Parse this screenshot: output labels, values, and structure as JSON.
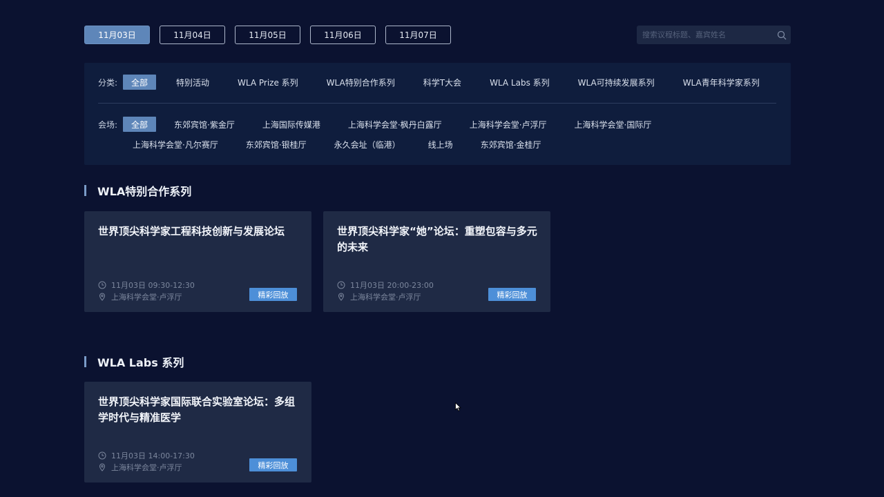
{
  "date_tabs": [
    "11月03日",
    "11月04日",
    "11月05日",
    "11月06日",
    "11月07日"
  ],
  "search": {
    "placeholder": "搜索议程标题、嘉宾姓名"
  },
  "category": {
    "label": "分类:",
    "options": [
      "全部",
      "特别活动",
      "WLA Prize 系列",
      "WLA特别合作系列",
      "科学T大会",
      "WLA Labs 系列",
      "WLA可持续发展系列",
      "WLA青年科学家系列"
    ]
  },
  "venue": {
    "label": "会场:",
    "options_row1": [
      "全部",
      "东郊宾馆·紫金厅",
      "上海国际传媒港",
      "上海科学会堂·枫丹白露厅",
      "上海科学会堂·卢浮厅",
      "上海科学会堂·国际厅"
    ],
    "options_row2": [
      "上海科学会堂·凡尔赛厅",
      "东郊宾馆·银桂厅",
      "永久会址（临港）",
      "线上场",
      "东郊宾馆·金桂厅"
    ]
  },
  "sections": [
    {
      "title": "WLA特别合作系列",
      "cards": [
        {
          "title": "世界顶尖科学家工程科技创新与发展论坛",
          "time": "11月03日 09:30-12:30",
          "venue": "上海科学会堂·卢浮厅",
          "button": "精彩回放"
        },
        {
          "title": "世界顶尖科学家“她”论坛：重塑包容与多元的未来",
          "time": "11月03日 20:00-23:00",
          "venue": "上海科学会堂·卢浮厅",
          "button": "精彩回放"
        }
      ]
    },
    {
      "title": "WLA Labs 系列",
      "cards": [
        {
          "title": "世界顶尖科学家国际联合实验室论坛：多组学时代与精准医学",
          "time": "11月03日 14:00-17:30",
          "venue": "上海科学会堂·卢浮厅",
          "button": "精彩回放"
        }
      ]
    }
  ],
  "colors": {
    "background": "#0b1230",
    "accent": "#5e86b9",
    "button": "#4d8fd8",
    "card": "#1f2a45"
  }
}
